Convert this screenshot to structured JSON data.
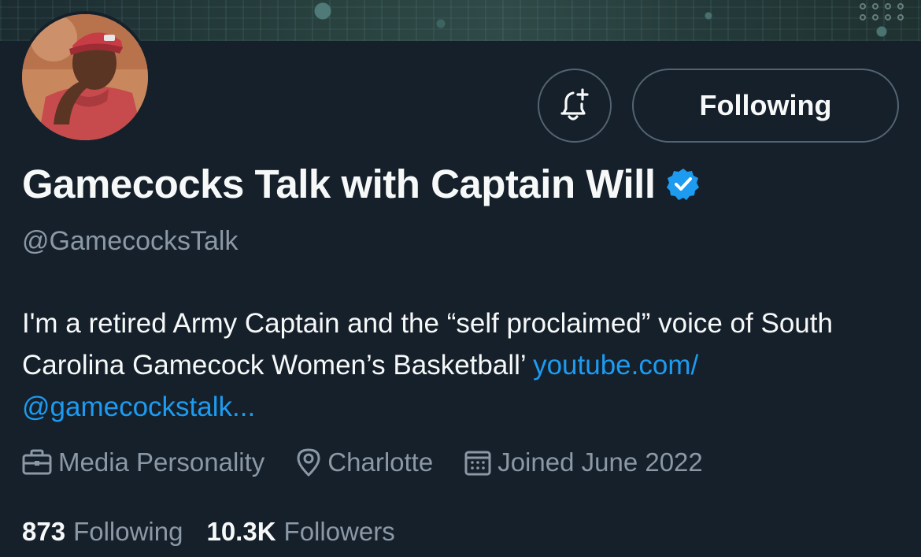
{
  "profile": {
    "display_name": "Gamecocks Talk with Captain Will",
    "handle": "@GamecocksTalk",
    "verified": true,
    "bio_text": "I'm a retired Army Captain and the “self proclaimed” voice of South Carolina Gamecock Women’s Basketball’ ",
    "bio_link_line1": "youtube.com/",
    "bio_link_line2": "@gamecockstalk..."
  },
  "actions": {
    "notify_icon": "bell-plus-icon",
    "follow_label": "Following"
  },
  "meta": {
    "category": "Media Personality",
    "location": "Charlotte",
    "joined": "Joined June 2022"
  },
  "stats": {
    "following_count": "873",
    "following_label": "Following",
    "followers_count": "10.3K",
    "followers_label": "Followers"
  },
  "colors": {
    "background": "#15202b",
    "accent": "#1d9bf0",
    "secondary_text": "#8b98a5",
    "border": "#536471"
  }
}
